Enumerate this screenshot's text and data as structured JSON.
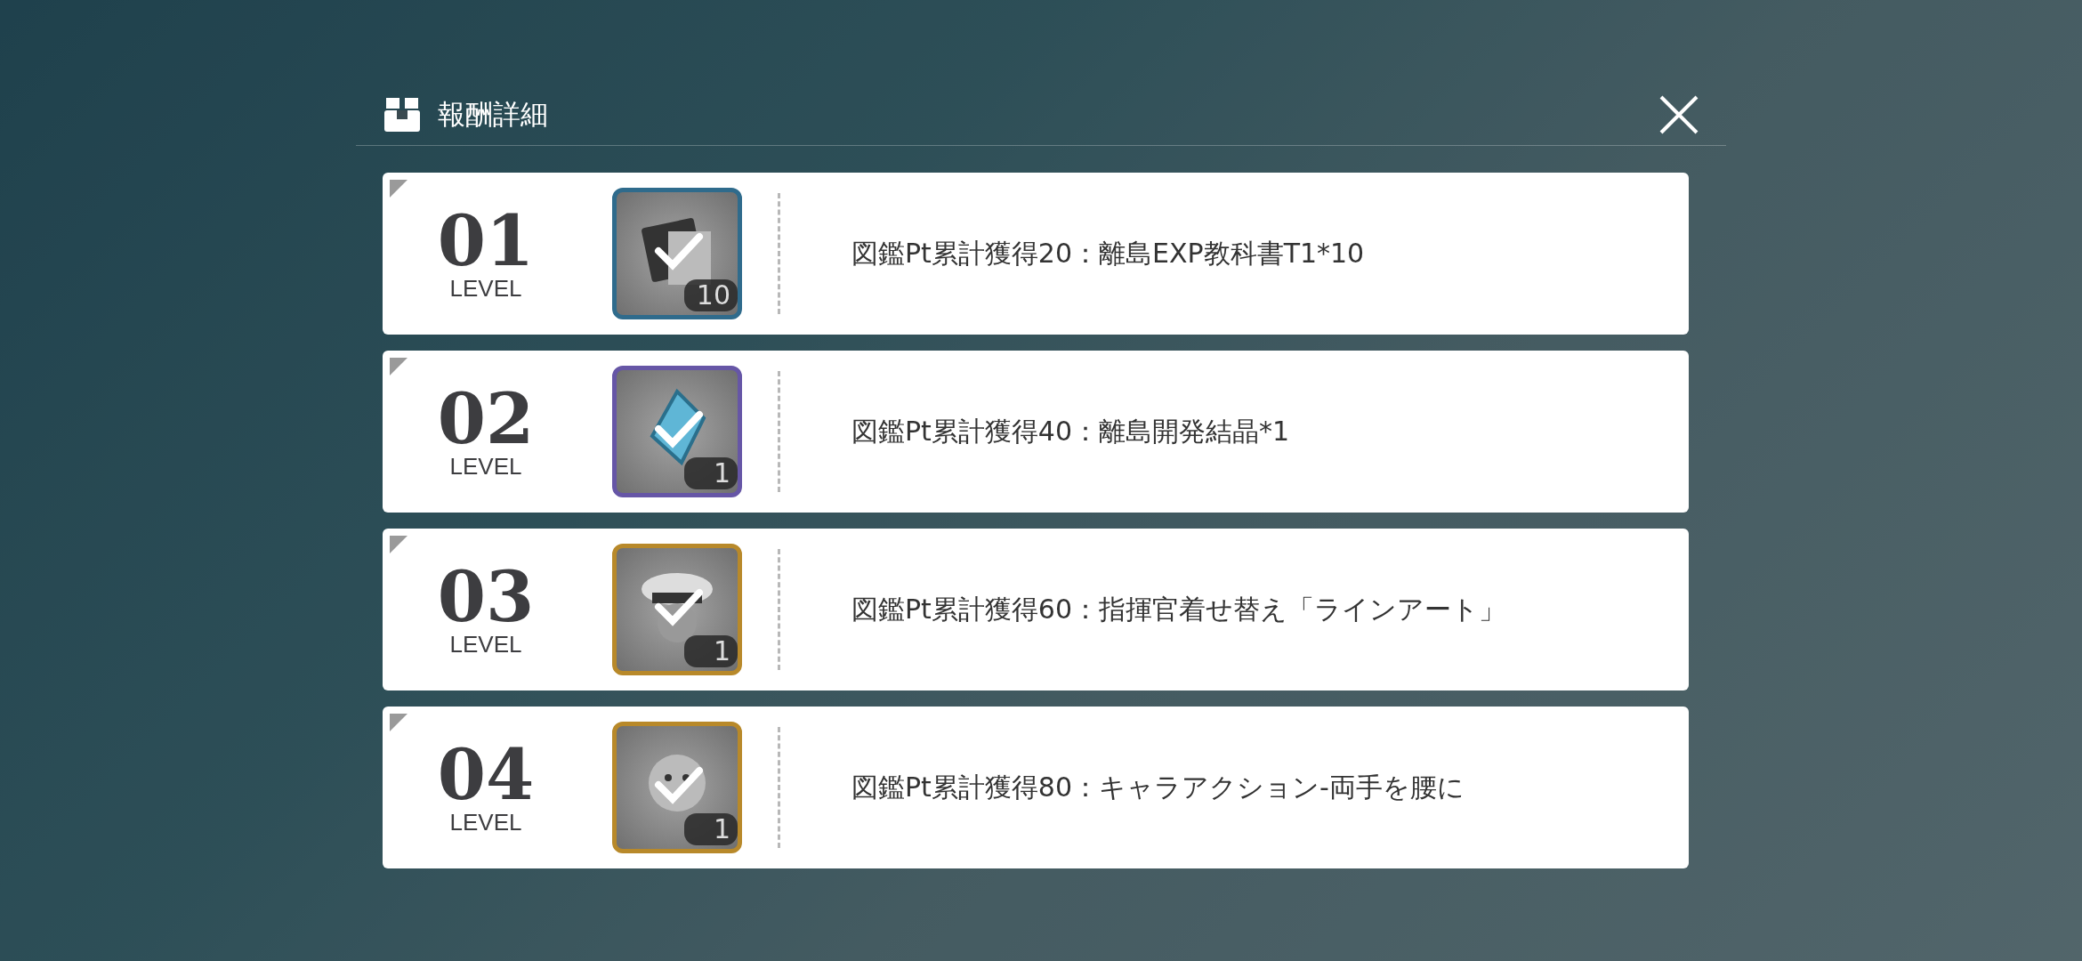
{
  "dialog": {
    "title": "報酬詳細"
  },
  "rewards": [
    {
      "level": "01",
      "level_label": "LEVEL",
      "kind": "book",
      "color": "#2f6b8c",
      "count": "10",
      "claimed": true,
      "text": "図鑑Pt累計獲得20：離島EXP教科書T1*10"
    },
    {
      "level": "02",
      "level_label": "LEVEL",
      "kind": "crystal",
      "color": "#6656a6",
      "count": "1",
      "claimed": true,
      "text": "図鑑Pt累計獲得40：離島開発結晶*1"
    },
    {
      "level": "03",
      "level_label": "LEVEL",
      "kind": "cap",
      "color": "#b8892a",
      "count": "1",
      "claimed": true,
      "text": "図鑑Pt累計獲得60：指揮官着せ替え「ラインアート」"
    },
    {
      "level": "04",
      "level_label": "LEVEL",
      "kind": "emote",
      "color": "#b8892a",
      "count": "1",
      "claimed": true,
      "text": "図鑑Pt累計獲得80：キャラアクション-両手を腰に"
    }
  ]
}
